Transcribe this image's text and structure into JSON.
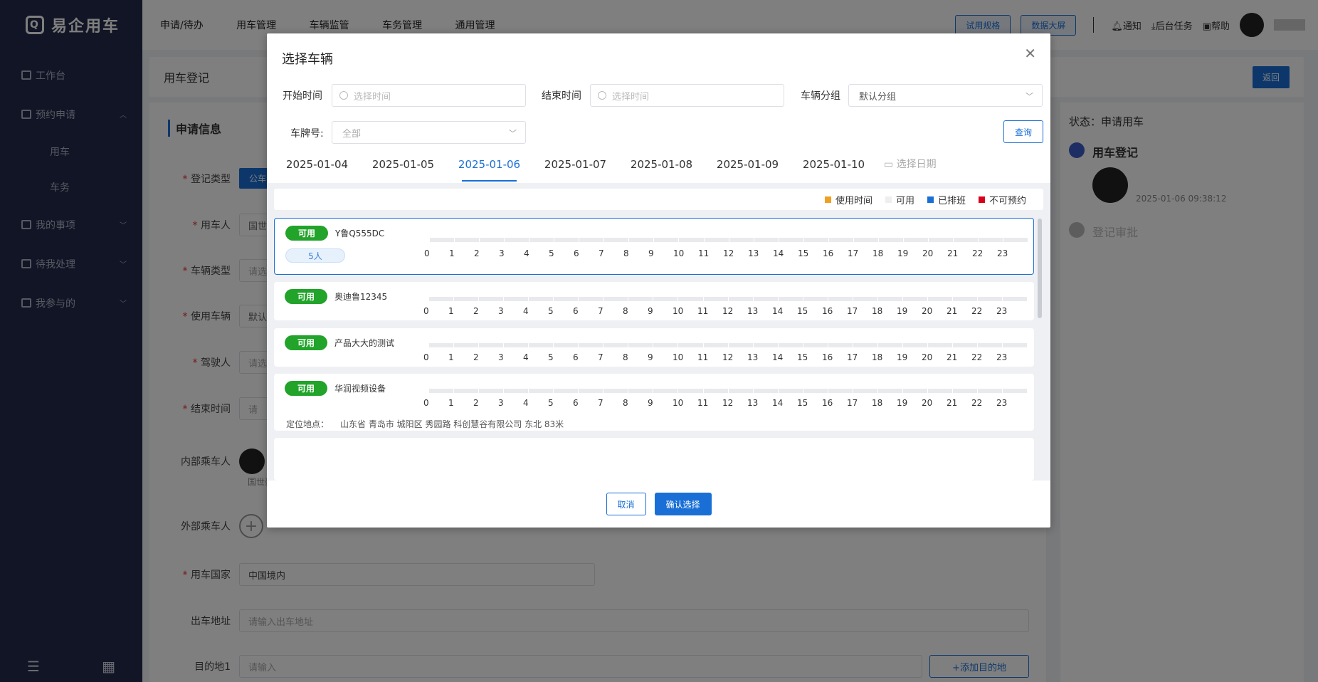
{
  "app": {
    "title": "易企用车"
  },
  "sidebar": {
    "items": [
      {
        "label": "工作台"
      },
      {
        "label": "预约申请"
      },
      {
        "label": "用车"
      },
      {
        "label": "车务"
      },
      {
        "label": "我的事项"
      },
      {
        "label": "待我处理"
      },
      {
        "label": "我参与的"
      }
    ]
  },
  "topnav": {
    "items": [
      "申请/待办",
      "用车管理",
      "车辆监管",
      "车务管理",
      "通用管理"
    ],
    "btn_trial": "试用规格",
    "btn_screen": "数据大屏",
    "notify": "通知",
    "tasks": "后台任务",
    "help": "帮助"
  },
  "page": {
    "title": "用车登记",
    "back": "返回",
    "section": "申请信息",
    "fields": {
      "reg_type": "登记类型",
      "reg_type_val": "公车",
      "user": "用车人",
      "user_val": "国世",
      "vehicle_type": "车辆类型",
      "vehicle_type_ph": "请选",
      "use_vehicle": "使用车辆",
      "use_vehicle_val": "默认",
      "driver": "驾驶人",
      "driver_ph": "请选",
      "end_time": "结束时间",
      "end_time_ph": "请",
      "inner_passengers": "内部乘车人",
      "inner_name": "国世豪",
      "outer_passengers": "外部乘车人",
      "country": "用车国家",
      "country_val": "中国境内",
      "from": "出车地址",
      "from_ph": "请输入出车地址",
      "dest": "目的地1",
      "dest_ph": "请输入",
      "add_dest": "+添加目的地"
    }
  },
  "right_panel": {
    "status": "状态：申请用车",
    "step1": "用车登记",
    "step1_time": "2025-01-06 09:38:12",
    "step2": "登记审批"
  },
  "modal": {
    "title": "选择车辆",
    "start_label": "开始时间",
    "start_ph": "选择时间",
    "end_label": "结束时间",
    "end_ph": "选择时间",
    "group_label": "车辆分组",
    "group_val": "默认分组",
    "plate_label": "车牌号:",
    "plate_val": "全部",
    "query": "查询",
    "dates": [
      "2025-01-04",
      "2025-01-05",
      "2025-01-06",
      "2025-01-07",
      "2025-01-08",
      "2025-01-09",
      "2025-01-10"
    ],
    "active_date": "2025-01-06",
    "date_pick": "选择日期",
    "legend": {
      "used": "使用时间",
      "available": "可用",
      "scheduled": "已排班",
      "unavailable": "不可预约"
    },
    "legend_colors": {
      "used": "#f0a020",
      "available": "#eeeeee",
      "scheduled": "#1a6fd6",
      "unavailable": "#d9001b"
    },
    "hours": [
      "0",
      "1",
      "2",
      "3",
      "4",
      "5",
      "6",
      "7",
      "8",
      "9",
      "10",
      "11",
      "12",
      "13",
      "14",
      "15",
      "16",
      "17",
      "18",
      "19",
      "20",
      "21",
      "22",
      "23"
    ],
    "vehicles": [
      {
        "status": "可用",
        "plate": "Y鲁Q555DC",
        "seats": "5人"
      },
      {
        "status": "可用",
        "plate": "奥迪鲁12345"
      },
      {
        "status": "可用",
        "plate": "产品大大的测试"
      },
      {
        "status": "可用",
        "plate": "华润视频设备",
        "loc_label": "定位地点：",
        "loc": "山东省 青岛市 城阳区 秀园路 科创慧谷有限公司 东北 83米"
      }
    ],
    "cancel": "取消",
    "confirm": "确认选择"
  }
}
